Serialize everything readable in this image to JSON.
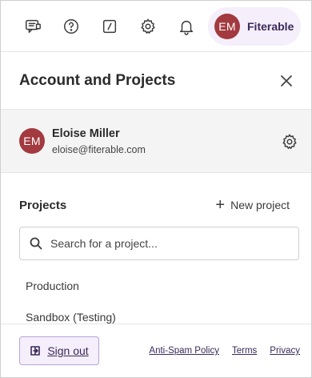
{
  "topbar": {
    "icons": [
      "feedback-icon",
      "help-icon",
      "command-icon",
      "settings-icon",
      "notifications-icon"
    ],
    "account": {
      "initials": "EM",
      "org_name": "Fiterable"
    }
  },
  "panel": {
    "title": "Account and Projects"
  },
  "user": {
    "initials": "EM",
    "name": "Eloise Miller",
    "email": "eloise@fiterable.com"
  },
  "projects": {
    "title": "Projects",
    "new_label": "New project",
    "search_placeholder": "Search for a project...",
    "items": [
      "Production",
      "Sandbox (Testing)"
    ]
  },
  "footer": {
    "signout_label": "Sign out",
    "links": [
      "Anti-Spam Policy",
      "Terms",
      "Privacy"
    ]
  },
  "colors": {
    "avatar": "#a23a3f",
    "accent_bg": "#f5eefb",
    "accent_border": "#b8a4d9"
  }
}
